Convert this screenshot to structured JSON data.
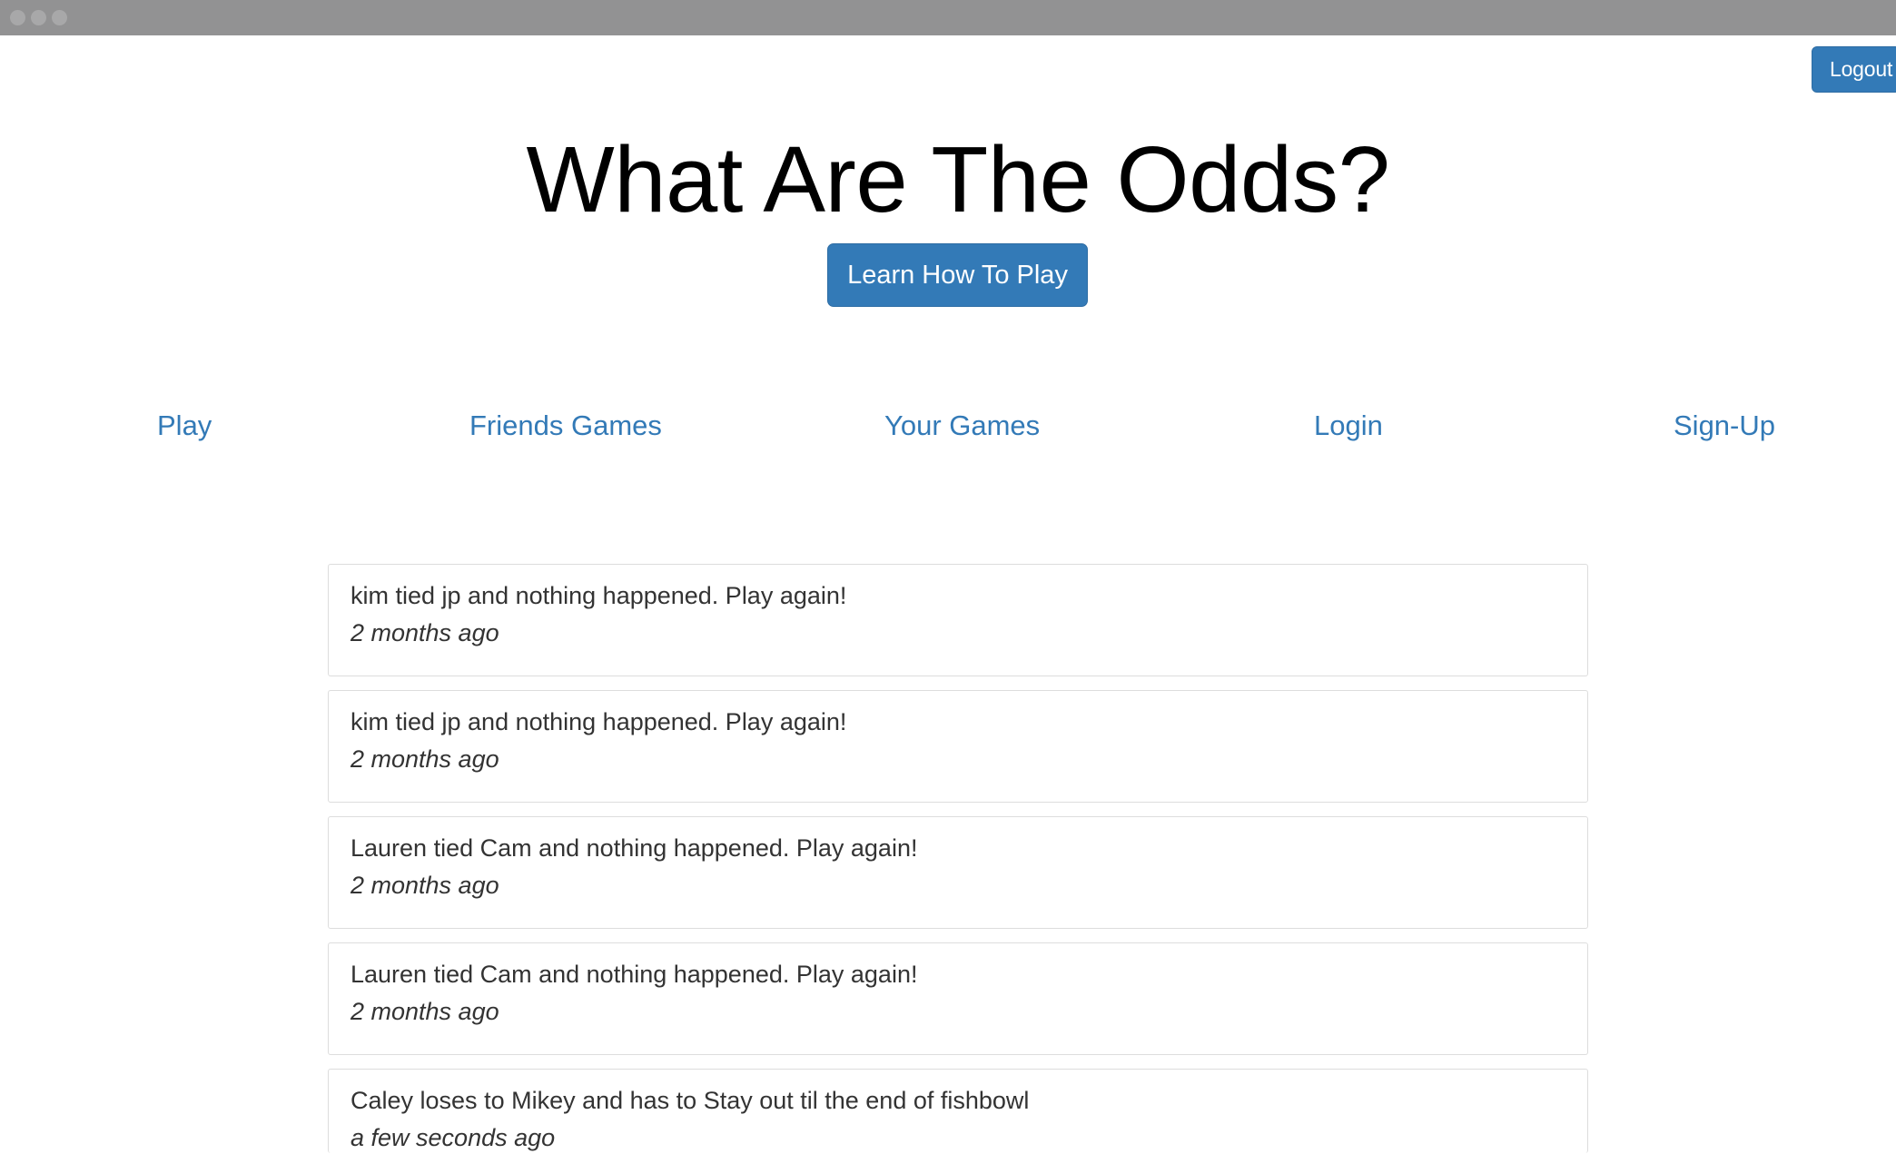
{
  "window": {
    "controls": [
      "close",
      "minimize",
      "zoom"
    ]
  },
  "header": {
    "logout_label": "Logout",
    "title": "What Are The Odds?",
    "learn_label": "Learn How To Play"
  },
  "nav": {
    "items": [
      {
        "label": "Play"
      },
      {
        "label": "Friends Games"
      },
      {
        "label": "Your Games"
      },
      {
        "label": "Login"
      },
      {
        "label": "Sign-Up"
      }
    ]
  },
  "feed": {
    "items": [
      {
        "text": "kim tied jp and nothing happened. Play again!",
        "time": "2 months ago"
      },
      {
        "text": "kim tied jp and nothing happened. Play again!",
        "time": "2 months ago"
      },
      {
        "text": "Lauren tied Cam and nothing happened. Play again!",
        "time": "2 months ago"
      },
      {
        "text": "Lauren tied Cam and nothing happened. Play again!",
        "time": "2 months ago"
      },
      {
        "text": "Caley loses to Mikey and has to Stay out til the end of fishbowl",
        "time": "a few seconds ago"
      }
    ]
  },
  "colors": {
    "primary": "#337ab7",
    "titlebar": "#929293",
    "border": "#dddddd",
    "text": "#333333"
  }
}
